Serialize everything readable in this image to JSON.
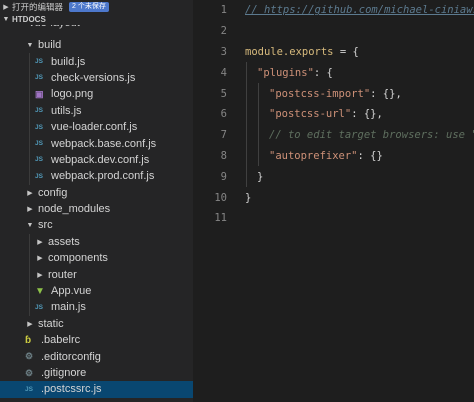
{
  "sidebar": {
    "open_editors": {
      "label": "打开的编辑器",
      "badge": "2 个未保存"
    },
    "root": {
      "label": "HTDOCS"
    },
    "partial_folder": "vue-layout",
    "items": [
      {
        "label": "build",
        "type": "folder",
        "expanded": true,
        "depth": 0
      },
      {
        "label": "build.js",
        "type": "js",
        "depth": 1
      },
      {
        "label": "check-versions.js",
        "type": "js",
        "depth": 1
      },
      {
        "label": "logo.png",
        "type": "image",
        "depth": 1
      },
      {
        "label": "utils.js",
        "type": "js",
        "depth": 1
      },
      {
        "label": "vue-loader.conf.js",
        "type": "js",
        "depth": 1
      },
      {
        "label": "webpack.base.conf.js",
        "type": "js",
        "depth": 1
      },
      {
        "label": "webpack.dev.conf.js",
        "type": "js",
        "depth": 1
      },
      {
        "label": "webpack.prod.conf.js",
        "type": "js",
        "depth": 1
      },
      {
        "label": "config",
        "type": "folder",
        "expanded": false,
        "depth": 0
      },
      {
        "label": "node_modules",
        "type": "folder",
        "expanded": false,
        "depth": 0
      },
      {
        "label": "src",
        "type": "folder",
        "expanded": true,
        "depth": 0
      },
      {
        "label": "assets",
        "type": "folder",
        "expanded": false,
        "depth": 1
      },
      {
        "label": "components",
        "type": "folder",
        "expanded": false,
        "depth": 1
      },
      {
        "label": "router",
        "type": "folder",
        "expanded": false,
        "depth": 1
      },
      {
        "label": "App.vue",
        "type": "vue",
        "depth": 1
      },
      {
        "label": "main.js",
        "type": "js",
        "depth": 1
      },
      {
        "label": "static",
        "type": "folder",
        "expanded": false,
        "depth": 0
      },
      {
        "label": ".babelrc",
        "type": "babel",
        "depth": 0
      },
      {
        "label": ".editorconfig",
        "type": "dotfile",
        "depth": 0
      },
      {
        "label": ".gitignore",
        "type": "dotfile",
        "depth": 0
      },
      {
        "label": ".postcssrc.js",
        "type": "js",
        "depth": 0,
        "selected": true
      }
    ]
  },
  "editor": {
    "line_numbers": [
      "1",
      "2",
      "3",
      "4",
      "5",
      "6",
      "7",
      "8",
      "9",
      "10",
      "11"
    ],
    "code": {
      "l1_comment": "// https://github.com/michael-ciniawsky/postcss-load-config",
      "l3_module": "module.exports",
      "l3_rest": " = {",
      "l4_key": "\"plugins\"",
      "l4_rest": ": {",
      "l5_key": "\"postcss-import\"",
      "l5_rest": ": {},",
      "l6_key": "\"postcss-url\"",
      "l6_rest": ": {},",
      "l7_comment": "// to edit target browsers: use \"browserslist\" field in package.json",
      "l8_key": "\"autoprefixer\"",
      "l8_rest": ": {}",
      "l9": "}",
      "l10": "}"
    }
  },
  "colors": {
    "sidebar_bg": "#252526",
    "editor_bg": "#1e1e1e",
    "selection": "#094771",
    "badge": "#4d78cc",
    "string": "#ce9178",
    "comment": "#6a9955",
    "js_icon": "#519aba"
  },
  "icons": {
    "folder_collapsed": "chevron-right-icon",
    "folder_expanded": "chevron-down-icon",
    "js_file": "js-file-icon",
    "image_file": "image-file-icon",
    "vue_file": "vue-file-icon",
    "babel_file": "babel-file-icon",
    "dot_file": "gear-file-icon"
  }
}
